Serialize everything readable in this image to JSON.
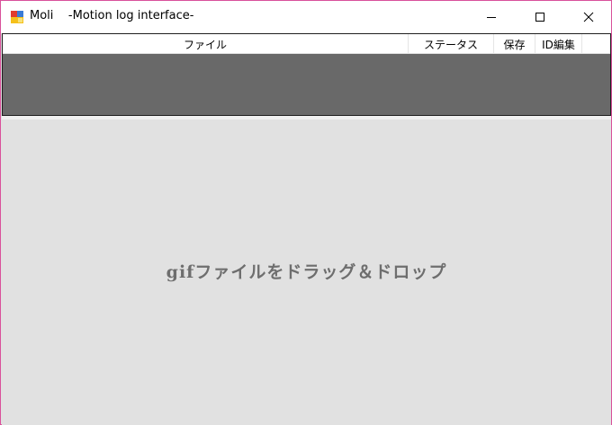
{
  "window": {
    "title": "Moli    -Motion log interface-",
    "icon": "app-logo-icon",
    "controls": [
      "minimize-icon",
      "maximize-icon",
      "close-icon"
    ]
  },
  "listview": {
    "columns": [
      "ファイル",
      "ステータス",
      "保存",
      "ID編集",
      ""
    ],
    "rows": [],
    "background_color": "#696969"
  },
  "droparea": {
    "label": "gifファイルをドラッグ＆ドロップ"
  },
  "colors": {
    "window_border": "#d9519b",
    "drop_background": "#e1e1e1",
    "drop_text": "#6e6e6e"
  }
}
